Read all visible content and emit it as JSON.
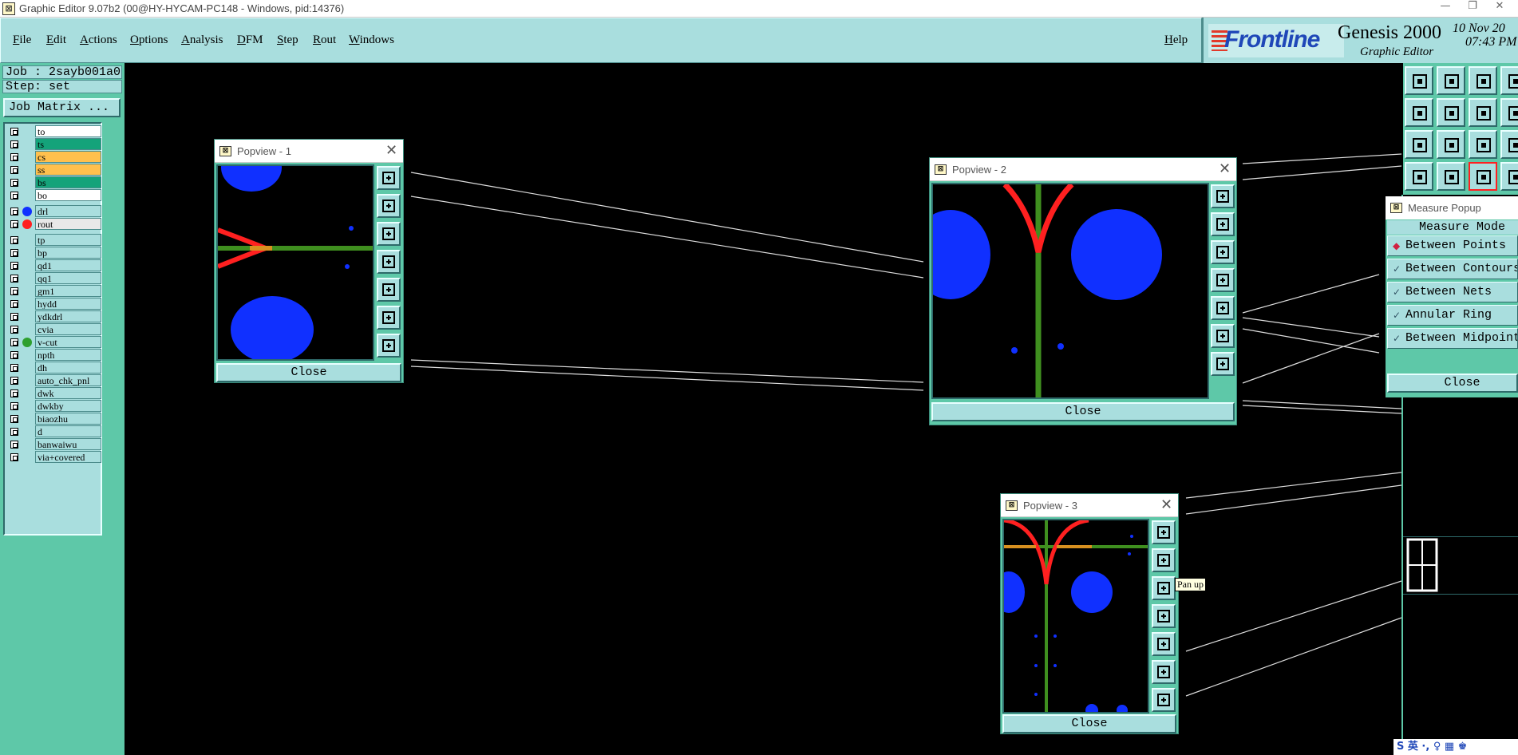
{
  "window": {
    "title": "Graphic Editor 9.07b2 (00@HY-HYCAM-PC148 - Windows, pid:14376)",
    "controls": [
      "—",
      "❐",
      "✕"
    ]
  },
  "menu": {
    "items": [
      "File",
      "Edit",
      "Actions",
      "Options",
      "Analysis",
      "DFM",
      "Step",
      "Rout",
      "Windows"
    ],
    "help": "Help"
  },
  "branding": {
    "logo": "Frontline",
    "product": "Genesis 2000",
    "subtitle": "Graphic Editor",
    "date": "10 Nov 20",
    "time": "07:43 PM"
  },
  "job": {
    "job_label": "Job : 2sayb001a0",
    "step_label": "Step: set",
    "matrix_button": "Job Matrix ..."
  },
  "layers": [
    {
      "name": "to",
      "bg": "#ffffff",
      "dot": ""
    },
    {
      "name": "ts",
      "bg": "#14a37a",
      "dot": ""
    },
    {
      "name": "cs",
      "bg": "#ffc04d",
      "dot": ""
    },
    {
      "name": "ss",
      "bg": "#ffc04d",
      "dot": ""
    },
    {
      "name": "bs",
      "bg": "#14a37a",
      "dot": ""
    },
    {
      "name": "bo",
      "bg": "#ffffff",
      "dot": ""
    },
    {
      "name": "drl",
      "bg": "#a9dede",
      "dot": "#1030ff"
    },
    {
      "name": "rout",
      "bg": "#e8e8e8",
      "dot": "#ff2020"
    },
    {
      "name": "tp",
      "bg": "#a9dede",
      "dot": ""
    },
    {
      "name": "bp",
      "bg": "#a9dede",
      "dot": ""
    },
    {
      "name": "qd1",
      "bg": "#a9dede",
      "dot": ""
    },
    {
      "name": "qq1",
      "bg": "#a9dede",
      "dot": ""
    },
    {
      "name": "gm1",
      "bg": "#a9dede",
      "dot": ""
    },
    {
      "name": "hydd",
      "bg": "#a9dede",
      "dot": ""
    },
    {
      "name": "ydkdrl",
      "bg": "#a9dede",
      "dot": ""
    },
    {
      "name": "cvia",
      "bg": "#a9dede",
      "dot": ""
    },
    {
      "name": "v-cut",
      "bg": "#a9dede",
      "dot": "#2fa02f"
    },
    {
      "name": "npth",
      "bg": "#a9dede",
      "dot": ""
    },
    {
      "name": "dh",
      "bg": "#a9dede",
      "dot": ""
    },
    {
      "name": "auto_chk_pnl",
      "bg": "#a9dede",
      "dot": ""
    },
    {
      "name": "dwk",
      "bg": "#a9dede",
      "dot": ""
    },
    {
      "name": "dwkby",
      "bg": "#a9dede",
      "dot": ""
    },
    {
      "name": "biaozhu",
      "bg": "#a9dede",
      "dot": ""
    },
    {
      "name": "d",
      "bg": "#a9dede",
      "dot": ""
    },
    {
      "name": "banwaiwu",
      "bg": "#a9dede",
      "dot": ""
    },
    {
      "name": "via+covered",
      "bg": "#a9dede",
      "dot": ""
    }
  ],
  "popview1": {
    "title": "Popview - 1",
    "close": "Close"
  },
  "popview2": {
    "title": "Popview - 2",
    "close": "Close"
  },
  "popview3": {
    "title": "Popview - 3",
    "close": "Close"
  },
  "tooltip": "Pan up",
  "measure": {
    "title": "Measure Popup",
    "mode_header": "Measure Mode",
    "options": [
      "Between Points",
      "Between Contours",
      "Between Nets",
      "Annular Ring",
      "Between Midpoints"
    ],
    "selected": "Between Points",
    "close": "Close"
  },
  "ime": "S 英 ·, ♀ ▦ ♚",
  "colors": {
    "panel": "#a9dede",
    "panel_dark": "#5ec8a8",
    "pad": "#1030ff",
    "rout": "#ff2020",
    "vcut": "#3f8f1f"
  }
}
